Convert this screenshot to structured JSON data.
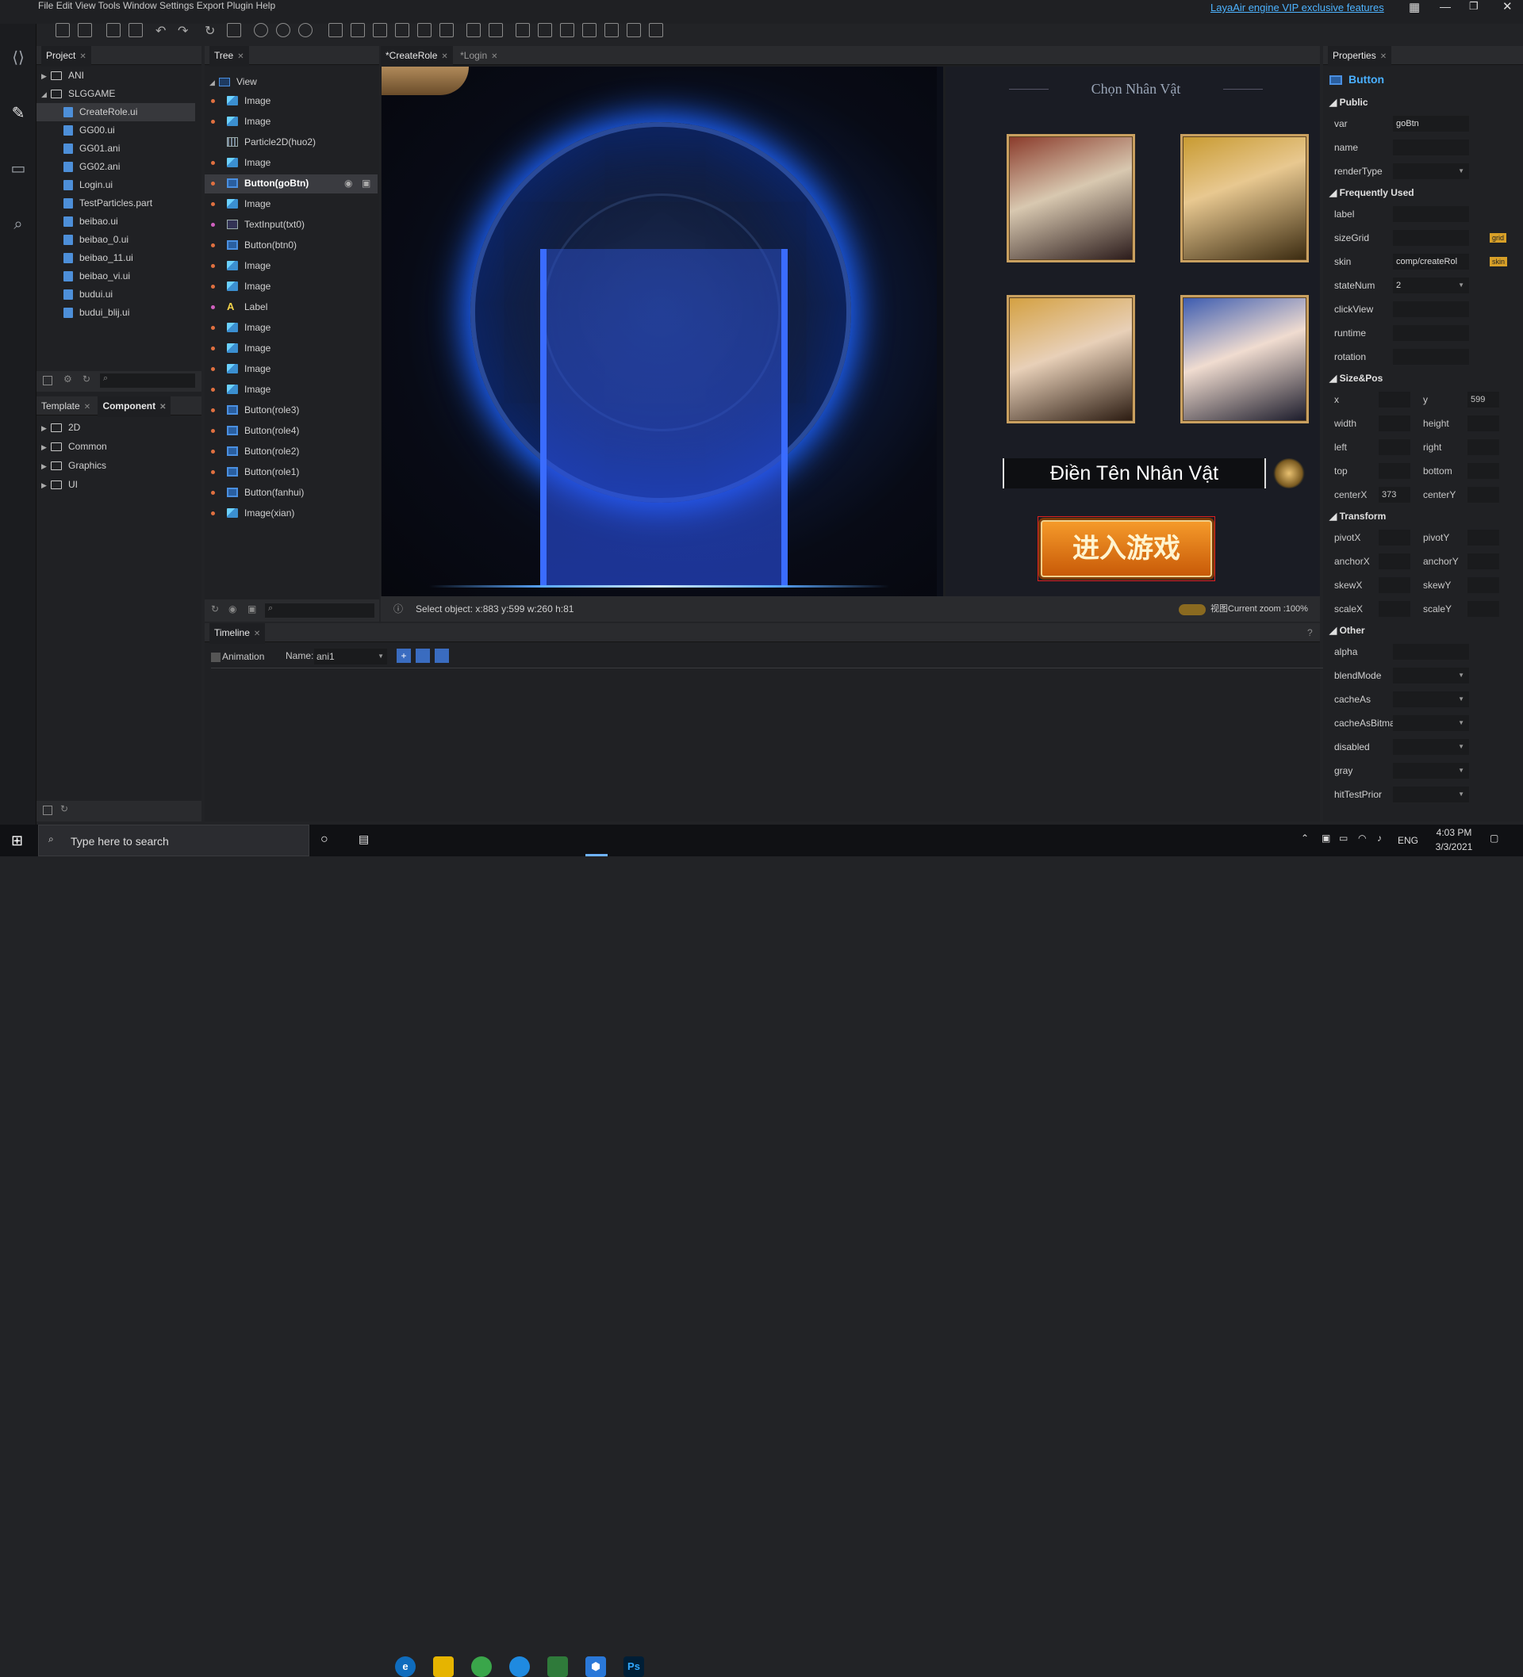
{
  "menu": [
    "File",
    "Edit",
    "View",
    "Tools",
    "Window",
    "Settings",
    "Export",
    "Plugin",
    "Help"
  ],
  "vip_link": "LayaAir engine VIP exclusive features",
  "project": {
    "tab": "Project",
    "items": [
      {
        "label": "ANI",
        "type": "folder",
        "collapsed": true
      },
      {
        "label": "SLGGAME",
        "type": "folder",
        "collapsed": false
      },
      {
        "label": "CreateRole.ui",
        "type": "file",
        "selected": true
      },
      {
        "label": "GG00.ui",
        "type": "file"
      },
      {
        "label": "GG01.ani",
        "type": "file"
      },
      {
        "label": "GG02.ani",
        "type": "file"
      },
      {
        "label": "Login.ui",
        "type": "file"
      },
      {
        "label": "TestParticles.part",
        "type": "file"
      },
      {
        "label": "beibao.ui",
        "type": "file"
      },
      {
        "label": "beibao_0.ui",
        "type": "file"
      },
      {
        "label": "beibao_11.ui",
        "type": "file"
      },
      {
        "label": "beibao_vi.ui",
        "type": "file"
      },
      {
        "label": "budui.ui",
        "type": "file"
      },
      {
        "label": "budui_blij.ui",
        "type": "file"
      }
    ]
  },
  "component": {
    "tabs": [
      "Template",
      "Component"
    ],
    "items": [
      "2D",
      "Common",
      "Graphics",
      "UI"
    ]
  },
  "tree": {
    "tab": "Tree",
    "root": "View",
    "items": [
      {
        "label": "Image",
        "icon": "img",
        "dot": "orange"
      },
      {
        "label": "Image",
        "icon": "img",
        "dot": "orange"
      },
      {
        "label": "Particle2D(huo2)",
        "icon": "part",
        "dot": ""
      },
      {
        "label": "Image",
        "icon": "img",
        "dot": "orange"
      },
      {
        "label": "Button(goBtn)",
        "icon": "btn",
        "dot": "orange",
        "selected": true
      },
      {
        "label": "Image",
        "icon": "img",
        "dot": "orange"
      },
      {
        "label": "TextInput(txt0)",
        "icon": "txt",
        "dot": "pink"
      },
      {
        "label": "Button(btn0)",
        "icon": "btn",
        "dot": "orange"
      },
      {
        "label": "Image",
        "icon": "img",
        "dot": "orange"
      },
      {
        "label": "Image",
        "icon": "img",
        "dot": "orange"
      },
      {
        "label": "Label",
        "icon": "lbl",
        "dot": "pink"
      },
      {
        "label": "Image",
        "icon": "img",
        "dot": "orange"
      },
      {
        "label": "Image",
        "icon": "img",
        "dot": "orange"
      },
      {
        "label": "Image",
        "icon": "img",
        "dot": "orange"
      },
      {
        "label": "Image",
        "icon": "img",
        "dot": "orange"
      },
      {
        "label": "Button(role3)",
        "icon": "btn",
        "dot": "orange"
      },
      {
        "label": "Button(role4)",
        "icon": "btn",
        "dot": "orange"
      },
      {
        "label": "Button(role2)",
        "icon": "btn",
        "dot": "orange"
      },
      {
        "label": "Button(role1)",
        "icon": "btn",
        "dot": "orange"
      },
      {
        "label": "Button(fanhui)",
        "icon": "btn",
        "dot": "orange"
      },
      {
        "label": "Image(xian)",
        "icon": "img",
        "dot": "orange"
      }
    ]
  },
  "editor": {
    "tabs": [
      "*CreateRole",
      "*Login"
    ],
    "scene_title": "Chọn Nhân Vật",
    "name_input": "Điền Tên Nhân Vật",
    "go_button": "进入游戏",
    "status": "Select object: x:883 y:599  w:260 h:81",
    "zoom": "视图Current zoom :100%"
  },
  "timeline": {
    "tab": "Timeline",
    "animation_label": "Animation",
    "name_label": "Name:",
    "name_value": "ani1"
  },
  "properties": {
    "tab": "Properties",
    "component": "Button",
    "public": {
      "title": "Public",
      "var_label": "var",
      "var_value": "goBtn",
      "name_label": "name",
      "renderType_label": "renderType"
    },
    "frequent": {
      "title": "Frequently Used",
      "label": "label",
      "sizeGrid": "sizeGrid",
      "sizeGrid_badge": "grid",
      "skin": "skin",
      "skin_value": "comp/createRol",
      "skin_badge": "skin",
      "stateNum": "stateNum",
      "stateNum_value": "2",
      "clickView": "clickView",
      "runtime": "runtime",
      "rotation": "rotation"
    },
    "sizepos": {
      "title": "Size&Pos",
      "x": "x",
      "y": "y",
      "y_value": "599",
      "width": "width",
      "height": "height",
      "left": "left",
      "right": "right",
      "top": "top",
      "bottom": "bottom",
      "centerX": "centerX",
      "centerX_value": "373",
      "centerY": "centerY"
    },
    "transform": {
      "title": "Transform",
      "pivotX": "pivotX",
      "pivotY": "pivotY",
      "anchorX": "anchorX",
      "anchorY": "anchorY",
      "skewX": "skewX",
      "skewY": "skewY",
      "scaleX": "scaleX",
      "scaleY": "scaleY"
    },
    "other": {
      "title": "Other",
      "alpha": "alpha",
      "blendMode": "blendMode",
      "cacheAs": "cacheAs",
      "cacheAsBitmap": "cacheAsBitmap",
      "disabled": "disabled",
      "gray": "gray",
      "hitTestPrior": "hitTestPrior"
    }
  },
  "taskbar": {
    "search_placeholder": "Type here to search",
    "lang": "ENG",
    "time": "4:03 PM",
    "date": "3/3/2021"
  },
  "colors": {
    "accent": "#3a8ee6",
    "link": "#4db3ff",
    "go_button": "#e07a12"
  }
}
